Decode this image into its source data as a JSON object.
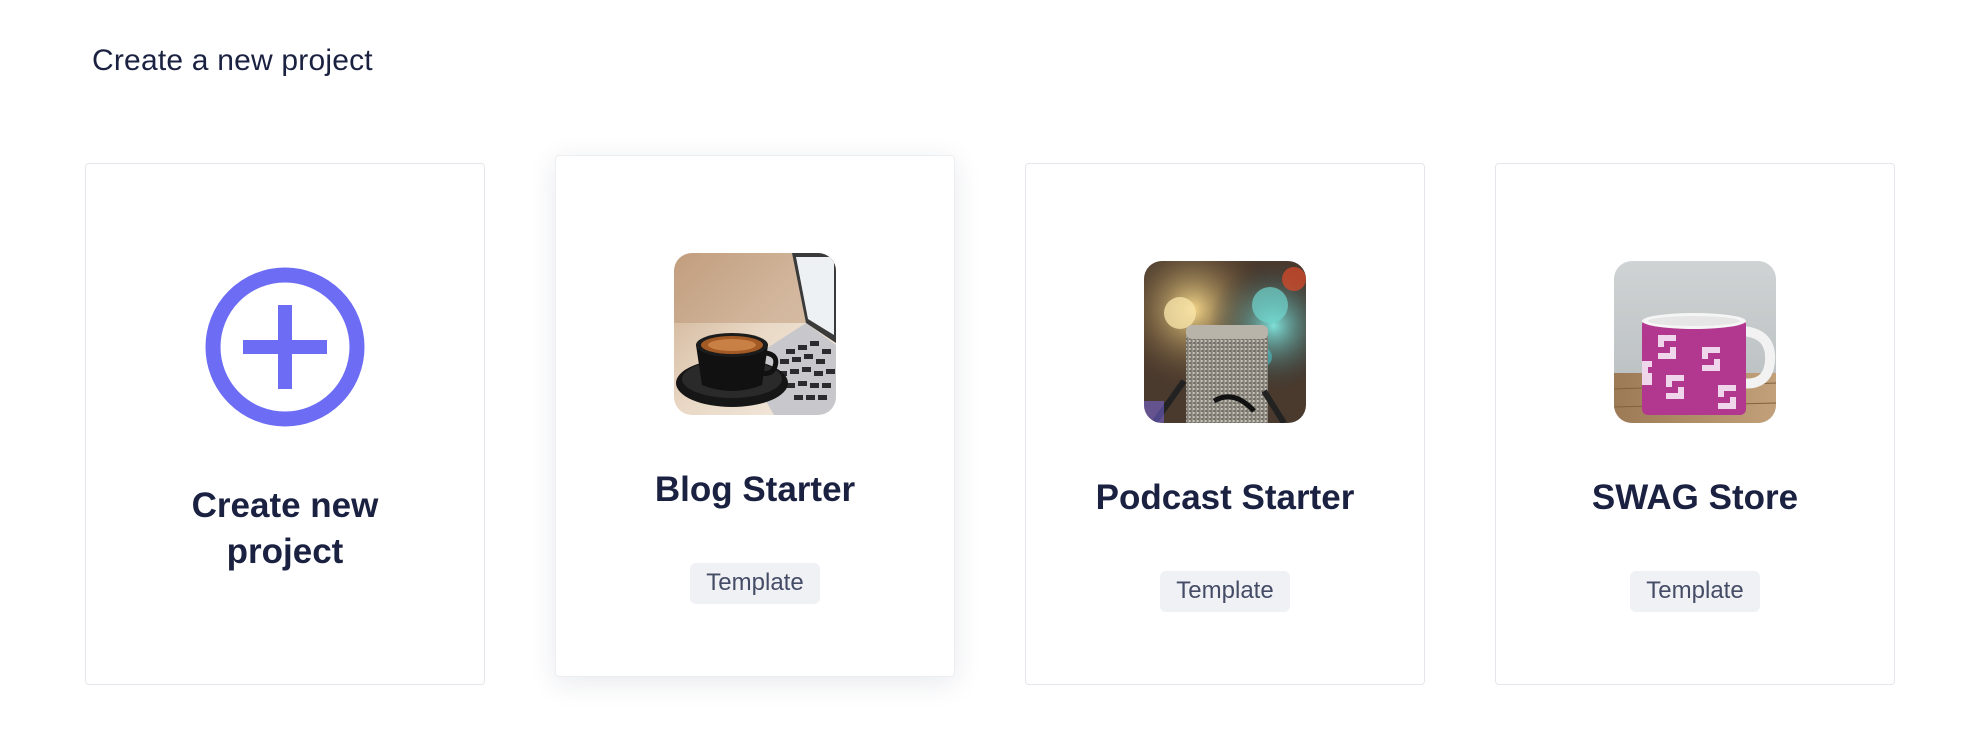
{
  "page": {
    "heading": "Create a new project"
  },
  "cards": [
    {
      "title": "Create new project",
      "kind": "create",
      "icon": "plus-circle-icon"
    },
    {
      "title": "Blog Starter",
      "badge": "Template",
      "image": "coffee-laptop"
    },
    {
      "title": "Podcast Starter",
      "badge": "Template",
      "image": "microphone"
    },
    {
      "title": "SWAG Store",
      "badge": "Template",
      "image": "mug"
    }
  ],
  "colors": {
    "accent": "#6c6cf5",
    "text": "#1b2141",
    "badge_bg": "#f0f1f5",
    "badge_text": "#454c66"
  }
}
